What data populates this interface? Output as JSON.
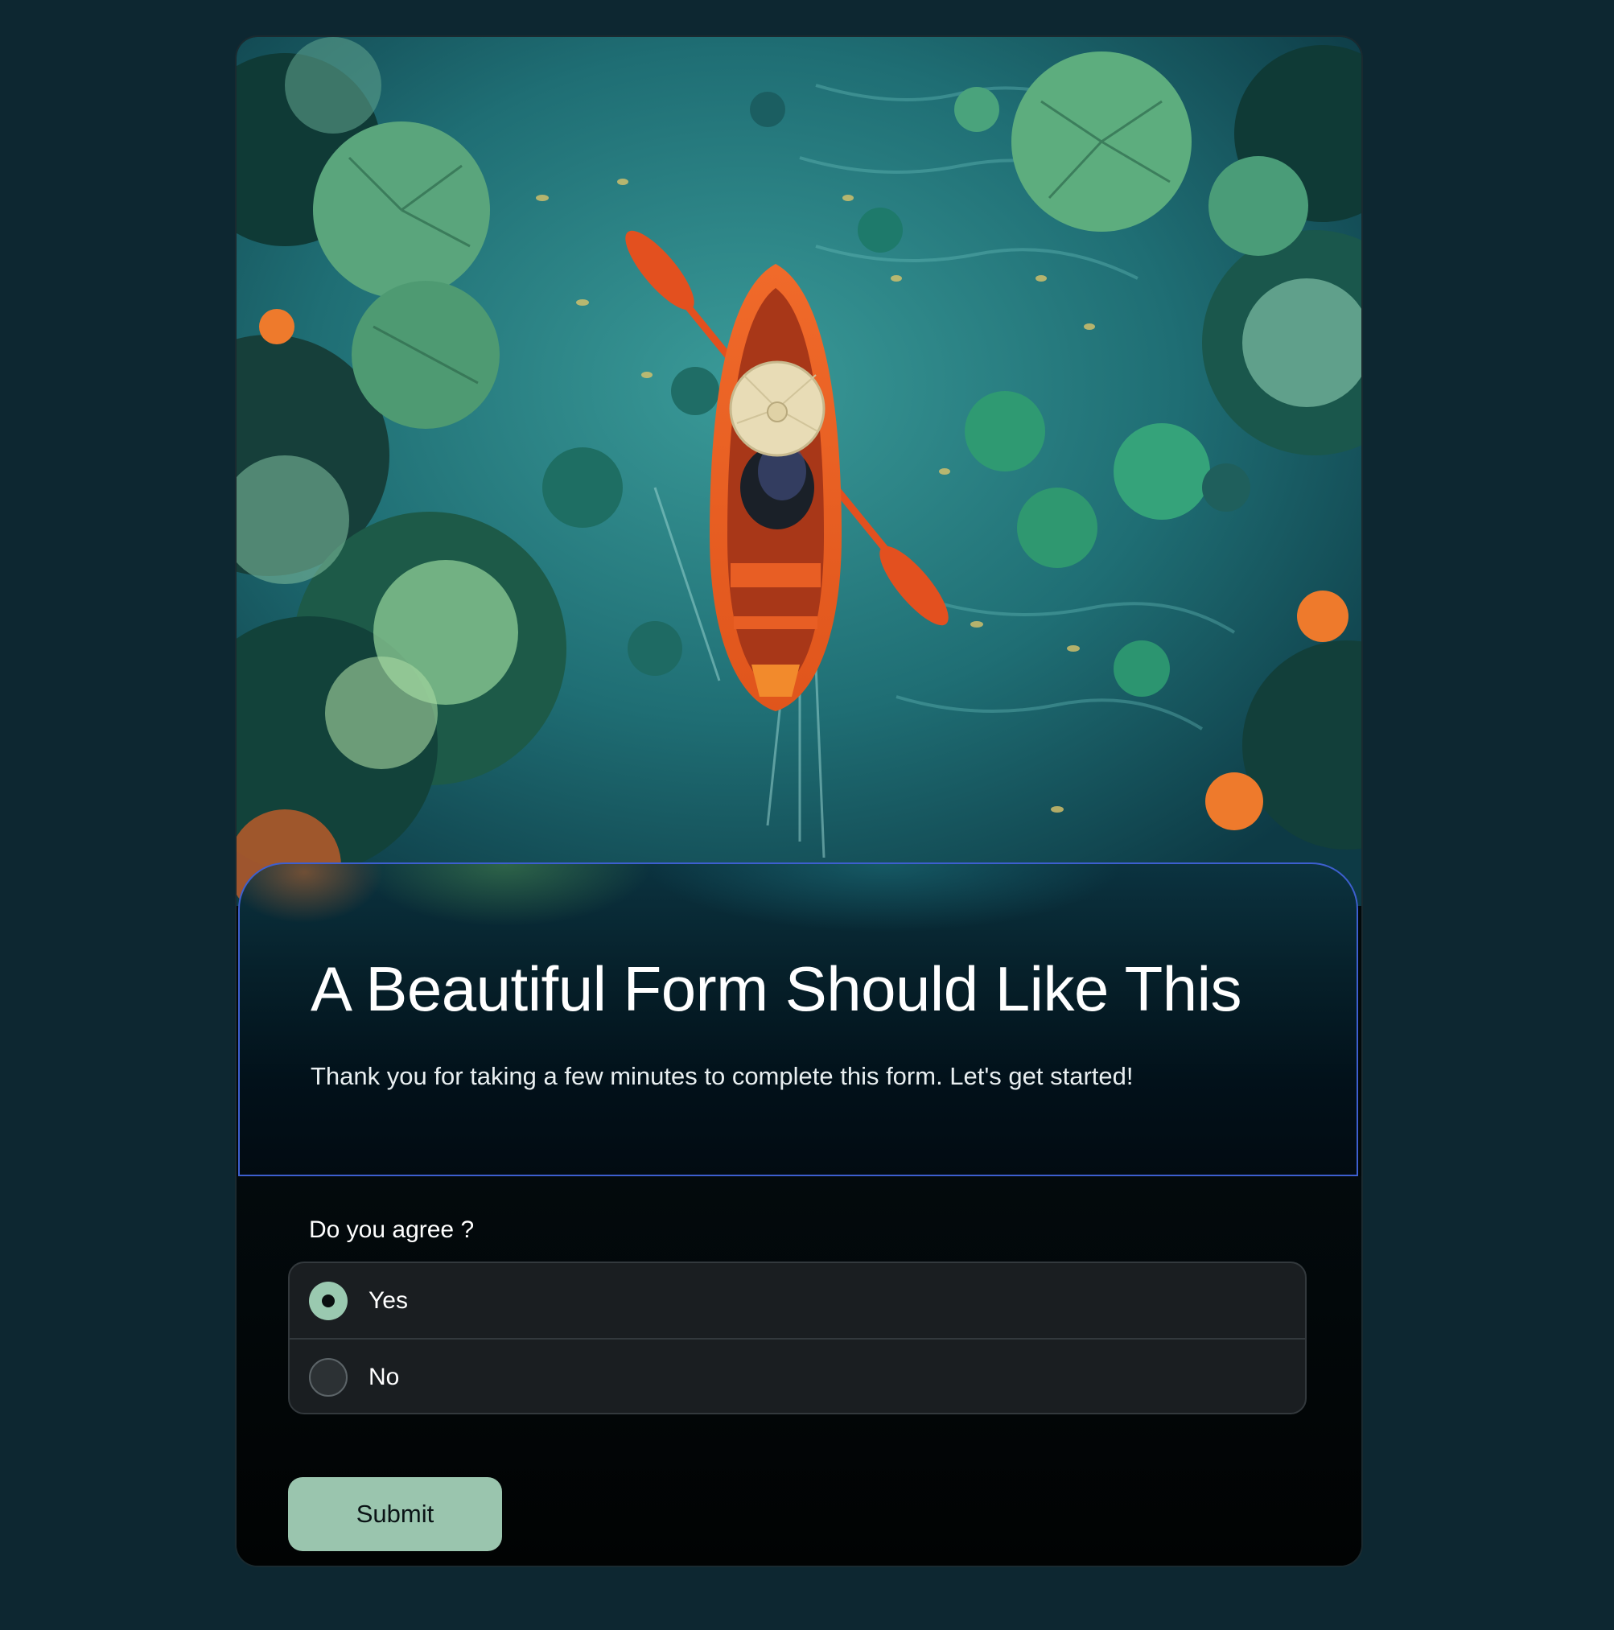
{
  "form": {
    "title": "A Beautiful Form Should Like This",
    "subtitle": "Thank you for taking a few minutes to complete this form. Let's get started!",
    "question": "Do you agree ?",
    "options": [
      {
        "label": "Yes",
        "selected": true
      },
      {
        "label": "No",
        "selected": false
      }
    ],
    "submit_label": "Submit"
  },
  "colors": {
    "page_background": "#0d2731",
    "header_border": "#3d5fcf",
    "accent": "#9ac5ae",
    "option_background": "#1a1e21"
  },
  "hero_image": {
    "alt": "Illustration of a person in a conical hat paddling a red canoe among lily pads and flowers, viewed from above"
  }
}
